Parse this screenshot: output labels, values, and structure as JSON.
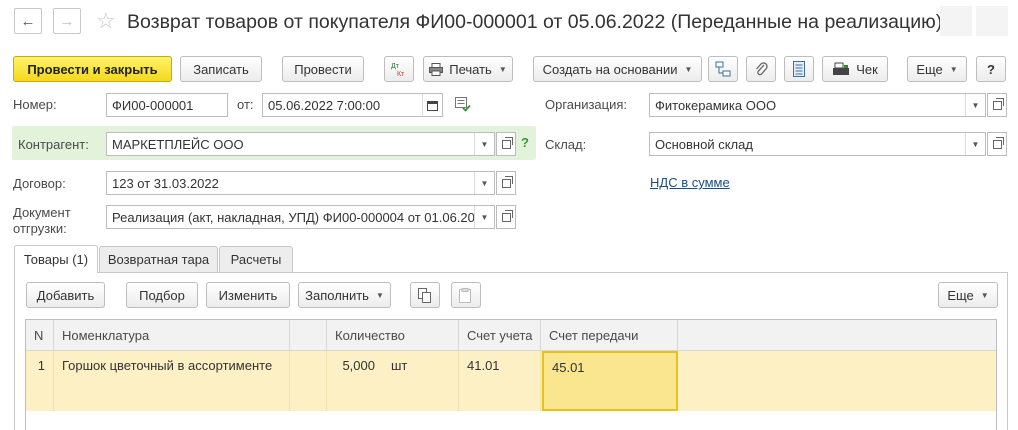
{
  "header": {
    "title": "Возврат товаров от покупателя ФИ00-000001 от 05.06.2022 (Переданные на реализацию)"
  },
  "toolbar": {
    "post_close": "Провести и закрыть",
    "save": "Записать",
    "post": "Провести",
    "print": "Печать",
    "create_based": "Создать на основании",
    "receipt": "Чек",
    "more": "Еще",
    "help": "?"
  },
  "form": {
    "number_label": "Номер:",
    "number_value": "ФИ00-000001",
    "from_label": "от:",
    "date_value": "05.06.2022  7:00:00",
    "org_label": "Организация:",
    "org_value": "Фитокерамика ООО",
    "contractor_label": "Контрагент:",
    "contractor_value": "МАРКЕТПЛЕЙС ООО",
    "help_mark": "?",
    "warehouse_label": "Склад:",
    "warehouse_value": "Основной склад",
    "contract_label": "Договор:",
    "contract_value": "123 от 31.03.2022",
    "vat_link": "НДС в сумме",
    "shipment_label_1": "Документ",
    "shipment_label_2": "отгрузки:",
    "shipment_value": "Реализация (акт, накладная, УПД) ФИ00-000004 от 01.06.20"
  },
  "tabs": [
    {
      "label": "Товары (1)"
    },
    {
      "label": "Возвратная тара"
    },
    {
      "label": "Расчеты"
    }
  ],
  "table_toolbar": {
    "add": "Добавить",
    "pick": "Подбор",
    "edit": "Изменить",
    "fill": "Заполнить",
    "more": "Еще"
  },
  "table": {
    "columns": [
      "N",
      "Номенклатура",
      "Количество",
      "Счет учета",
      "Счет передачи"
    ],
    "rows": [
      {
        "n": "1",
        "item": "Горшок цветочный в ассортименте",
        "qty": "5,000",
        "unit": "шт",
        "account": "41.01",
        "transfer_account": "45.01"
      }
    ]
  }
}
